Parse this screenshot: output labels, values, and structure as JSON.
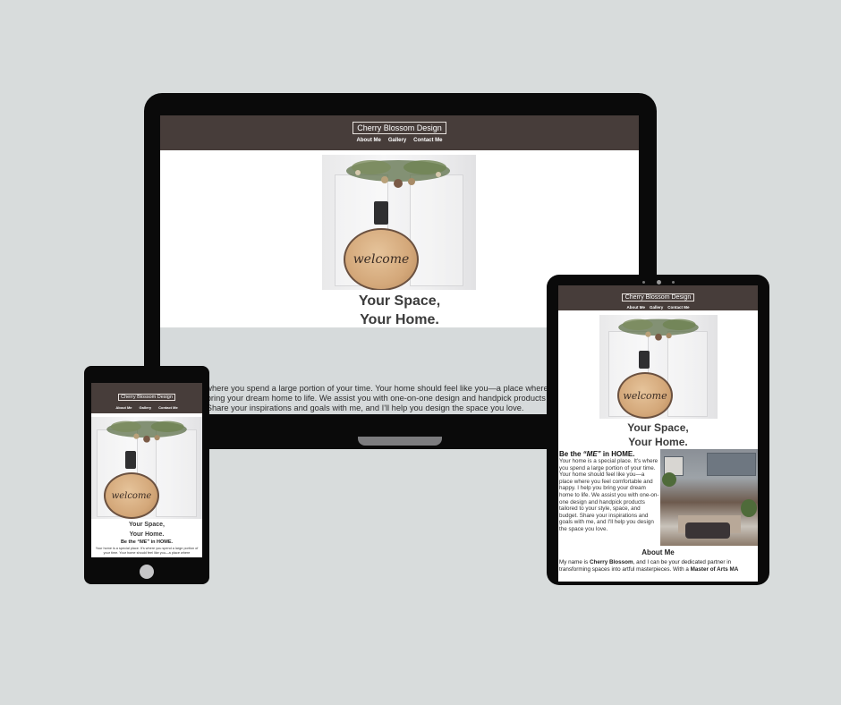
{
  "site": {
    "logo": "Cherry Blossom Design",
    "nav": [
      "About Me",
      "Gallery",
      "Contact Me"
    ],
    "hero_title_line1": "Your Space,",
    "hero_title_line2": "Your Home.",
    "sign_text": "welcome",
    "be_heading_prefix": "Be the ",
    "be_heading_me": "“ME”",
    "be_heading_suffix": " in HOME.",
    "be_text": "Your home is a special place. It's where you spend a large portion of your time. Your home should feel like you—a place where you feel comfortable and happy. I help you bring your dream home to life. We assist you with one-on-one design and handpick products tailored to your style, space, and budget. Share your inspirations and goals with me, and I'll help you design the space you love.",
    "about_heading": "About Me",
    "about_prefix": "My name is ",
    "about_name": "Cherry Blossom",
    "about_middle": ", and I can be your dedicated partner in transforming spaces into artful masterpieces. With a ",
    "about_degree": "Master of Arts MA"
  },
  "laptop": {
    "visible_text_line1": "s where you spend a large portion of your time. Your home should feel like you—a place where",
    "visible_text_line2": "u bring your dream home to life. We assist you with one-on-one design and handpick products",
    "visible_text_line3": "t. Share your inspirations and goals with me, and I'll help you design the space you love."
  },
  "phone": {
    "be_text": "Your home is a special place. It's where you spend a large portion of your time. Your home should feel like you—a place where"
  },
  "colors": {
    "background": "#d8dcdc",
    "header": "#473d3a",
    "device": "#0a0a0a"
  }
}
